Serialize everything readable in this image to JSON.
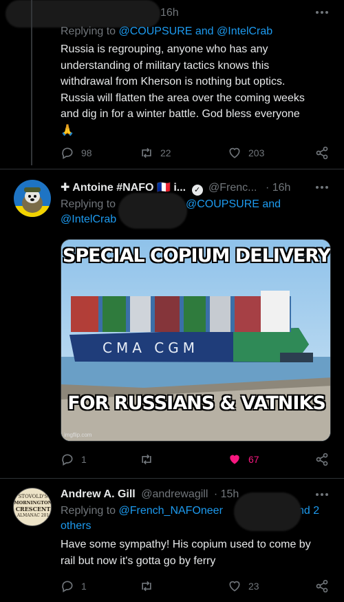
{
  "tweet1": {
    "time": "16h",
    "replying_prefix": "Replying to",
    "replying_handles": "@COUPSURE and @IntelCrab",
    "text_lines": [
      "Russia is regrouping, anyone who has any",
      "understanding of military tactics knows this",
      "withdrawal from Kherson is nothing but optics.",
      "Russia will flatten the area over the coming weeks",
      "and dig in for a winter battle. God bless everyone",
      "🙏"
    ],
    "replies": "98",
    "retweets": "22",
    "likes": "203"
  },
  "tweet2": {
    "name": "✚ Antoine #NAFO",
    "flag": "🇫🇷",
    "name_trunc": "i...",
    "handle": "@Frenc...",
    "time": "· 16h",
    "replying_prefix": "Replying to",
    "replying_handle_a": "@COUPSURE and",
    "replying_handle_b": "@IntelCrab",
    "image": {
      "top_text": "SPECIAL COPIUM DELIVERY",
      "bottom_text": "FOR RUSSIANS & VATNIKS",
      "ship_brand": "CMA CGM",
      "watermark": "imgflip.com"
    },
    "replies": "1",
    "retweets": "",
    "likes": "67"
  },
  "tweet3": {
    "name": "Andrew A. Gill",
    "handle": "@andrewagill",
    "time": "· 15h",
    "replying_prefix": "Replying to",
    "replying_handle": "@French_NAFOneer",
    "replying_tail": "nd 2",
    "replying_others": "others",
    "text_lines": [
      "Have some sympathy! His copium used to come by",
      "rail but now it's gotta go by ferry"
    ],
    "avatar_lines": [
      "STOVOLD'S",
      "MORNINGTON",
      "CRESCENT",
      "ALMANAC 201"
    ],
    "replies": "1",
    "retweets": "",
    "likes": "23"
  },
  "colors": {
    "accent": "#1d9bf0",
    "like_active": "#f91880",
    "muted": "#71767b",
    "bg": "#000000"
  }
}
